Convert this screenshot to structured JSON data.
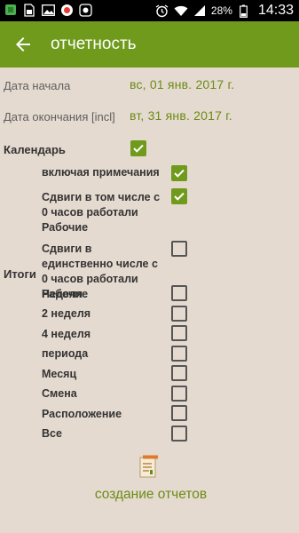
{
  "status": {
    "battery": "28%",
    "time": "14:33"
  },
  "appbar": {
    "title": "отчетность"
  },
  "start": {
    "label": "Дата начала",
    "value": "вс, 01 янв. 2017 г."
  },
  "end": {
    "label": "Дата окончания [incl]",
    "value": "вт, 31 янв. 2017 г."
  },
  "calendar": {
    "label": "Календарь",
    "checked": true
  },
  "totals_label": "Итоги",
  "options": [
    {
      "label": "включая примечания",
      "checked": true
    },
    {
      "label": "Сдвиги в том числе с 0 часов работали Рабочие",
      "checked": true
    },
    {
      "label": "Сдвиги в единственно числе с 0 часов работали Рабочие",
      "checked": false
    },
    {
      "label": "Неделя",
      "checked": false
    },
    {
      "label": "2 неделя",
      "checked": false
    },
    {
      "label": "4 неделя",
      "checked": false
    },
    {
      "label": "периода",
      "checked": false
    },
    {
      "label": "Месяц",
      "checked": false
    },
    {
      "label": "Смена",
      "checked": false
    },
    {
      "label": "Расположение",
      "checked": false
    },
    {
      "label": "Все",
      "checked": false
    }
  ],
  "report_button": {
    "label": "создание отчетов",
    "icon": "report-icon"
  },
  "colors": {
    "accent": "#6f9a1b",
    "background": "#e5dad0"
  }
}
